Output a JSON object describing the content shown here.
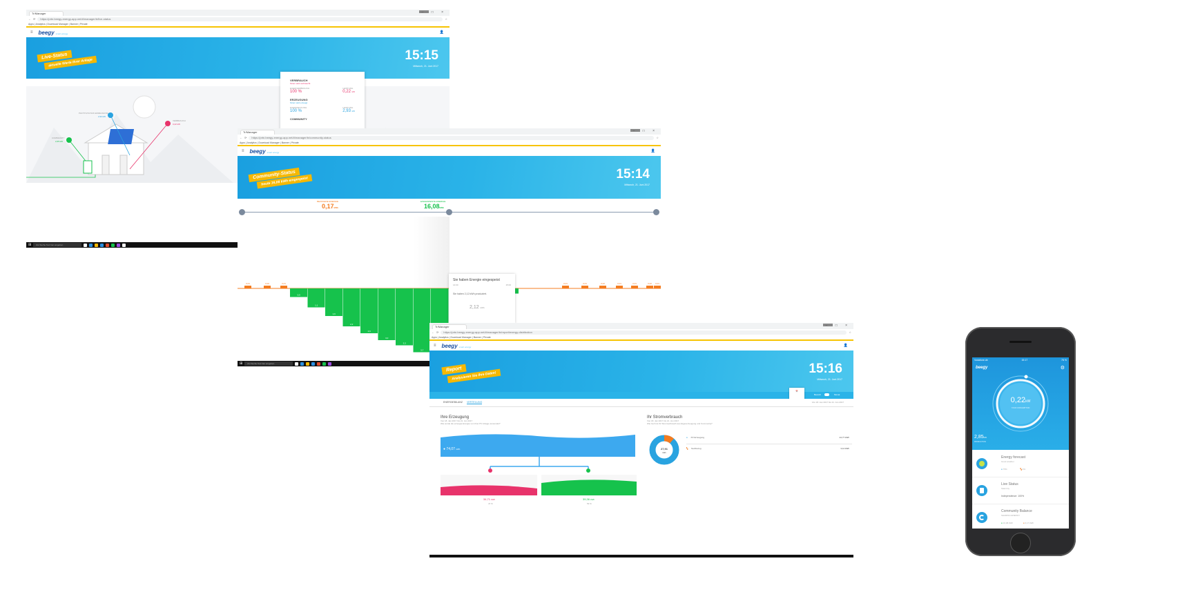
{
  "browser": {
    "tab_label": "Tr/Manager",
    "bookmarks": "Apps  |  Analytics  |  Download Manager  |  Banner  |  Private",
    "win_controls": "– □ ×"
  },
  "app": {
    "logo": "beegy",
    "logo_sub": "smart energy"
  },
  "win1": {
    "url": "https://prtn.beegy-energy-app.net/#/manager/tr/live-status",
    "ribbon_line1": "Live-Status",
    "ribbon_line2": "aktuelle Werte Ihrer Anlage",
    "time": "15:15",
    "date": "Mittwoch, 21. Juni 2017",
    "panel": {
      "sections": [
        {
          "title": "VERBRAUCH",
          "subtitle": "Strom wird verbraucht",
          "left_label": "EIGENVERBRAUCH",
          "left_value": "100 %",
          "right_label": "LEISTUNG",
          "right_value": "0,22",
          "right_unit": "kW",
          "color": "#e8336b"
        },
        {
          "title": "ERZEUGUNG",
          "subtitle": "Strom wird erzeugt",
          "left_label": "EIGENDECKUNG",
          "left_value": "100 %",
          "right_label": "LEISTUNG",
          "right_value": "2,93",
          "right_unit": "kW",
          "color": "#29a3e0"
        }
      ],
      "community_title": "COMMUNITY"
    },
    "pv_label": "PHOTOVOLTAIK ERZEUGUNG",
    "pv_value": "2,93 kW",
    "cons_label": "VERBRAUCH",
    "cons_value": "0,22 kW",
    "comm_label": "COMMUNITY",
    "comm_value": "2,65 kW",
    "taskbar_search": "Zur Suche Text hier eingeben"
  },
  "win2": {
    "url": "https://prtn.beegy-energy-app.net/#/manager/tr/community-status",
    "ribbon_line1": "Community-Status",
    "ribbon_line2": "heute 16,08 kWh eingespeist",
    "time": "15:14",
    "date": "Mittwoch, 21. Juni 2017",
    "bezogen_label": "BEZOGENE ENERGIE",
    "bezogen_value": "0,17",
    "bezogen_unit": "kWh",
    "eingespeist_label": "EINGESPEISTE ENERGIE",
    "eingespeist_value": "16,08",
    "eingespeist_unit": "kWh",
    "tooltip_title": "Sie haben Energie eingespeist",
    "tooltip_left": "14:00",
    "tooltip_right": "15:00",
    "tooltip_text": "Sie haben 2,12 kWh produziert.",
    "tooltip_value": "2,12",
    "tooltip_unit": "kWh",
    "neg_labels": [
      "0,5",
      "1,1",
      "1,6",
      "2,2",
      "2,6",
      "3,0",
      "3,3",
      "3,7",
      "3,9",
      "2,8",
      "1,5",
      "0,6",
      "0,3"
    ],
    "pos_labels": [
      "0,01",
      "0,02",
      "0,01",
      "0,01",
      "0,01",
      "0,02",
      "0,01",
      "0,01",
      "0,02",
      "0,01"
    ],
    "taskbar_search": "Zur Suche Text hier eingeben"
  },
  "win3": {
    "url": "https://prtn.beegy-energy-app.net/#/manager/tr/report/energy-distribution",
    "ribbon_line1": "Report",
    "ribbon_line2": "Analysieren Sie Ihre Daten!",
    "time": "15:16",
    "date": "Mittwoch, 21. Juni 2017",
    "tabs": [
      "ENERGIEBILANZ",
      "VERTEILUNG"
    ],
    "period": "Bereich",
    "period_right": "Monat",
    "date_range": "Von 18. Jan 2017 bis 21. Jun 2017",
    "erzeugung": {
      "title": "Ihre Erzeugung",
      "subtitle": "Von 18. Jan 2017 bis 21. Jun 2017",
      "desc": "Wie wurde die erzeugte Energie von Ihrer PV Anlage verwendet?",
      "total_value": "74,07",
      "total_unit": "kWh",
      "left_value": "34,71",
      "left_unit": "kWh",
      "left_pct": "47 %",
      "right_value": "39,36",
      "right_unit": "kWh",
      "right_pct": "53 %"
    },
    "verbrauch": {
      "title": "Ihr Stromverbrauch",
      "subtitle": "Von 18. Jan 2017 bis 21. Jun 2017",
      "desc": "Wie hoch ist Ihr Stromverbrauch aus Eigenerzeugung und Community?",
      "donut_value": "27,91",
      "donut_unit": "kWh",
      "rows": [
        {
          "label": "PV Erzeugung",
          "value": "24,77 kWh",
          "color": "#29a3e0"
        },
        {
          "label": "Netzbezug",
          "value": "3,14 kWh",
          "color": "#f47c20"
        }
      ]
    }
  },
  "phone": {
    "carrier": "Vodafone.de",
    "time": "15:17",
    "battery": "78 %",
    "logo": "beegy",
    "gauge_value": "0,22",
    "gauge_unit": "kW",
    "gauge_label": "YOUR CONSUMPTION",
    "prod_value": "2,85",
    "prod_unit": "kW",
    "prod_label": "PRODUCTION",
    "cards": [
      {
        "title": "Energy forecast",
        "sub": "Good weather",
        "extra_left": "75%",
        "extra_right": "0%",
        "color": "#c6e24a"
      },
      {
        "title": "Live Status",
        "sub": "Stand-by",
        "extra_left": "Independence: 100%",
        "extra_right": "",
        "color": "#29a3e0"
      },
      {
        "title": "Community Balance",
        "sub": "SHARING ENERGY",
        "extra_left": "16,08 kWh",
        "extra_right": "0,17 kWh",
        "color": "#29a3e0"
      }
    ]
  }
}
